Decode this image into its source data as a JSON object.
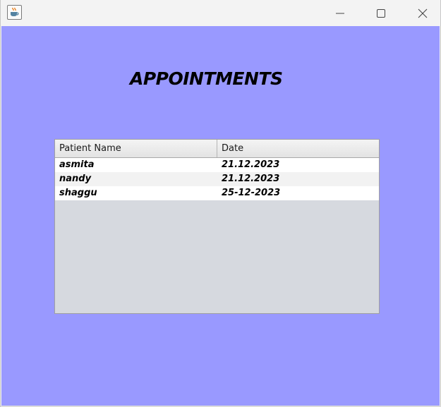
{
  "window": {
    "app_icon": "java-coffee-cup-icon",
    "controls": [
      "minimize-icon",
      "maximize-icon",
      "close-icon"
    ]
  },
  "page": {
    "heading": "APPOINTMENTS",
    "background_color": "#9999ff"
  },
  "table": {
    "columns": [
      "Patient Name",
      "Date"
    ],
    "rows": [
      [
        "asmita",
        "21.12.2023"
      ],
      [
        "nandy",
        "21.12.2023"
      ],
      [
        "shaggu",
        "25-12-2023"
      ]
    ]
  }
}
